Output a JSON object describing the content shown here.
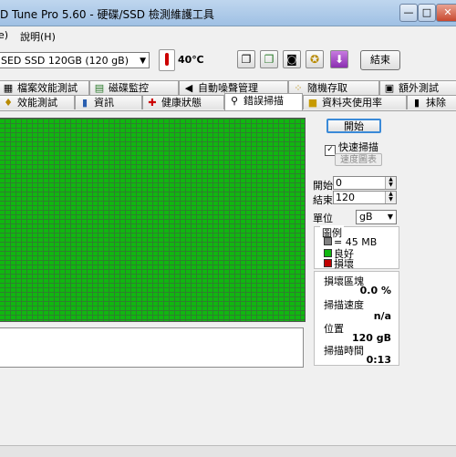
{
  "window": {
    "title": "D Tune Pro 5.60 - 硬碟/SSD 檢測維護工具",
    "minimize": "—",
    "maximize": "□",
    "close": "✕"
  },
  "menu": {
    "file": "e)",
    "help": "說明(H)"
  },
  "toolbar": {
    "drive": "SED SSD 120GB (120 gB)",
    "temperature": "40℃",
    "exit_label": "結束",
    "icons": [
      "copy-icon",
      "copy-alt-icon",
      "camera-icon",
      "tools-icon",
      "download-icon"
    ]
  },
  "tabs_top": [
    {
      "label": "檔案效能測試",
      "icon": "file-benchmark-icon"
    },
    {
      "label": "磁碟監控",
      "icon": "monitor-chart-icon"
    },
    {
      "label": "自動噪聲管理",
      "icon": "speaker-icon"
    },
    {
      "label": "隨機存取",
      "icon": "random-access-icon"
    },
    {
      "label": "額外測試",
      "icon": "extra-test-icon"
    }
  ],
  "tabs_bottom": [
    {
      "label": "效能測試",
      "icon": "benchmark-icon"
    },
    {
      "label": "資訊",
      "icon": "info-icon"
    },
    {
      "label": "健康狀態",
      "icon": "health-icon"
    },
    {
      "label": "錯誤掃描",
      "icon": "magnifier-icon",
      "active": true
    },
    {
      "label": "資料夾使用率",
      "icon": "folder-icon"
    },
    {
      "label": "抹除",
      "icon": "trash-icon"
    }
  ],
  "scan": {
    "start_button": "開始",
    "quick_scan_label": "快速掃描",
    "quick_scan_checked": true,
    "speed_map_button": "速度圖表",
    "start_label": "開始",
    "start_value": "0",
    "end_label": "結束",
    "end_value": "120",
    "unit_label": "單位",
    "unit_value": "gB"
  },
  "legend": {
    "title": "圖例",
    "items": [
      {
        "label": "= 45 MB",
        "color": "#808080"
      },
      {
        "label": "良好",
        "color": "#10b710"
      },
      {
        "label": "損壞",
        "color": "#c00000"
      }
    ]
  },
  "stats": {
    "damaged_blocks_label": "損壞區塊",
    "damaged_blocks_value": "0.0 %",
    "scan_speed_label": "掃描速度",
    "scan_speed_value": "n/a",
    "position_label": "位置",
    "position_value": "120 gB",
    "scan_time_label": "掃描時間",
    "scan_time_value": "0:13"
  },
  "colors": {
    "good_block": "#10b710",
    "grid_line": "#2f7f2f",
    "accent_button": "#3a8ad8"
  }
}
